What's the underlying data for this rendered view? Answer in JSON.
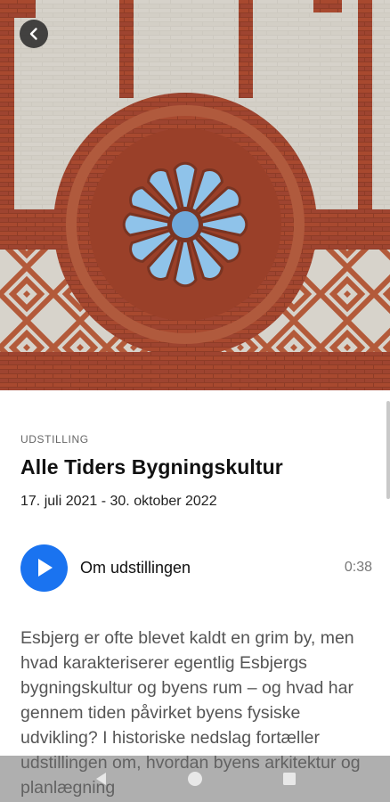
{
  "hero": {
    "image": "brick-rose-window-facade",
    "back_icon": "chevron-left-icon"
  },
  "exhibition": {
    "category": "UDSTILLING",
    "title": "Alle Tiders Bygningskultur",
    "dates": "17. juli 2021 - 30. oktober 2022"
  },
  "audio": {
    "play_icon": "play-icon",
    "label": "Om udstillingen",
    "duration": "0:38"
  },
  "description": "Esbjerg er ofte blevet kaldt en grim by, men hvad karakteriserer egentlig Esbjergs bygningskultur og byens rum – og hvad har gennem tiden påvirket byens fysiske udvikling? I historiske nedslag fortæller udstillingen om, hvordan byens arkitektur og planlægning",
  "navbar": {
    "back_icon": "nav-back-icon",
    "home_icon": "nav-home-icon",
    "recents_icon": "nav-recents-icon"
  },
  "colors": {
    "accent": "#1a73f0",
    "brick": "#a5472e",
    "glass": "#8fc3ea",
    "wall": "#c9c5bc"
  }
}
